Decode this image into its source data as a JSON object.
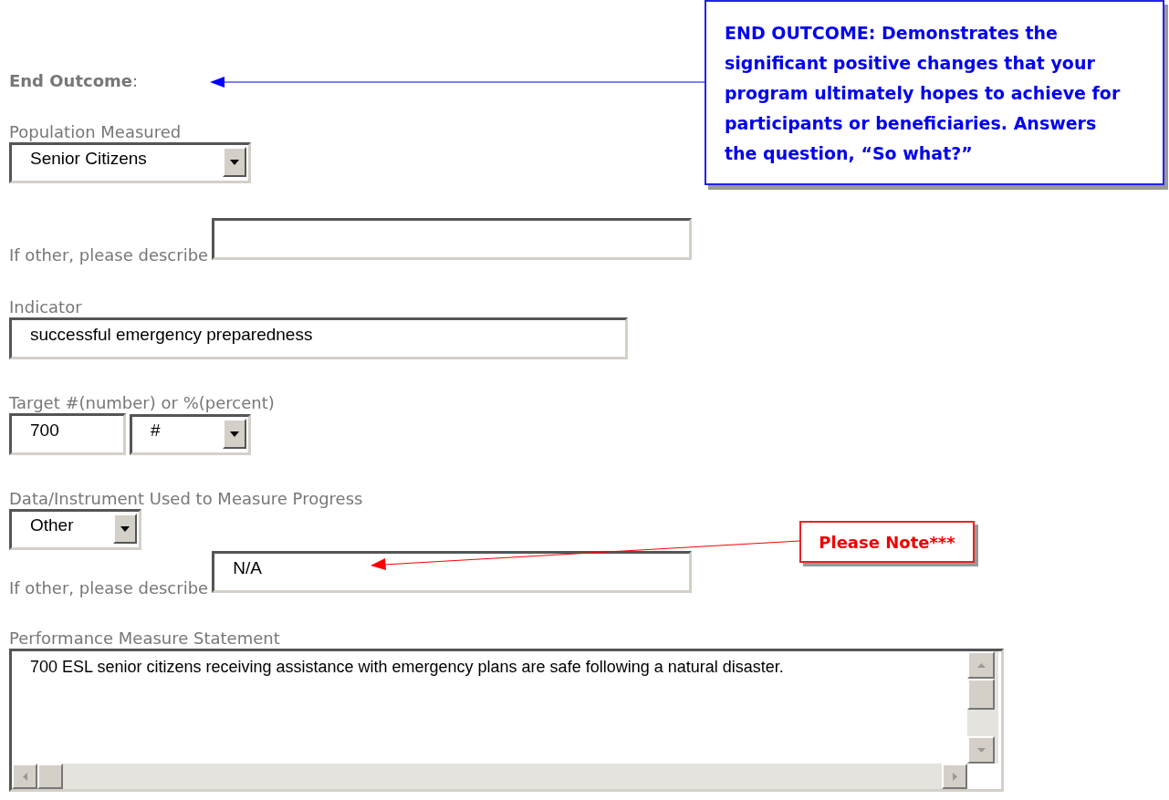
{
  "section_label": "End Outcome",
  "section_colon": ":",
  "callout": {
    "text": "END OUTCOME: Demonstrates the significant positive changes that your program ultimately hopes to achieve for participants or beneficiaries. Answers the question, “So what?”"
  },
  "population": {
    "label": "Population Measured",
    "value": "Senior Citizens"
  },
  "population_other": {
    "label": "If other, please describe"
  },
  "indicator": {
    "label": "Indicator",
    "value": "successful emergency preparedness"
  },
  "target": {
    "label": "Target #(number) or %(percent)",
    "value": "700",
    "unit": "#"
  },
  "instrument": {
    "label": "Data/Instrument Used to Measure Progress",
    "value": "Other"
  },
  "instrument_other": {
    "label": "If other, please describe",
    "value": "N/A"
  },
  "note": {
    "text": "Please Note***"
  },
  "statement": {
    "label": "Performance Measure Statement",
    "value": "700 ESL senior citizens receiving assistance with emergency plans are safe following a natural disaster."
  }
}
